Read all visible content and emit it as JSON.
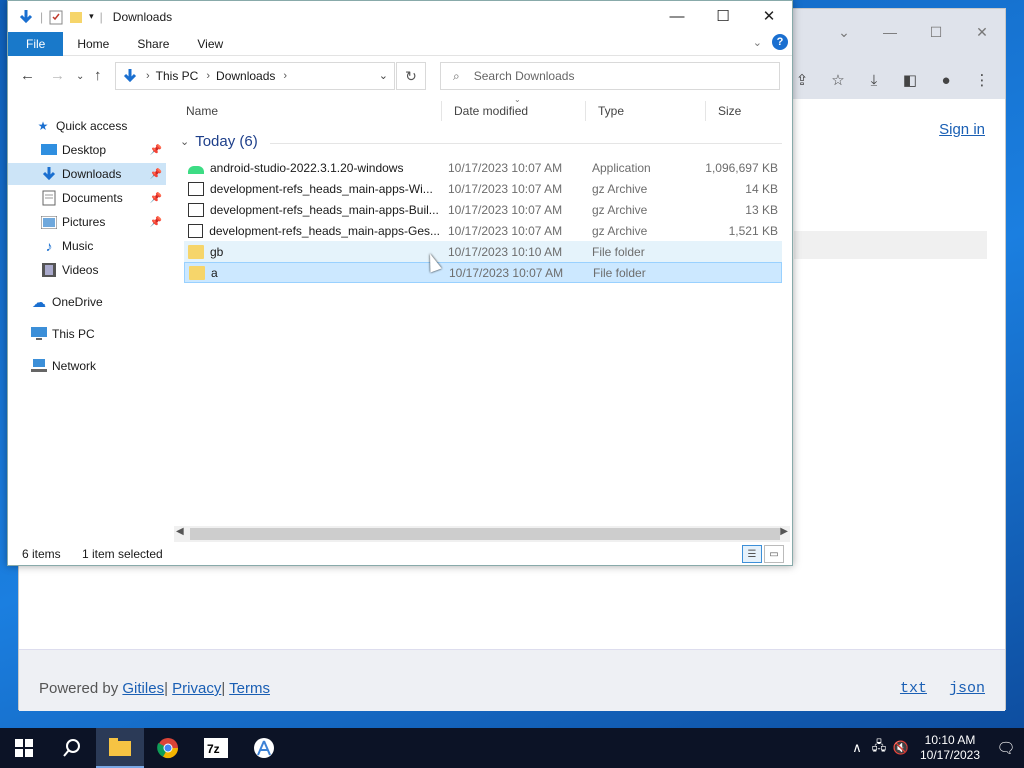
{
  "browser": {
    "sign_in": "Sign in",
    "footer_powered": "Powered by",
    "footer_gitiles": "Gitiles",
    "footer_privacy": "Privacy",
    "footer_terms": "Terms",
    "footer_txt": "txt",
    "footer_json": "json",
    "sep": "|"
  },
  "explorer": {
    "title": "Downloads",
    "ribbon_tabs": [
      "File",
      "Home",
      "Share",
      "View"
    ],
    "help": "?",
    "address": {
      "crumbs": [
        "This PC",
        "Downloads"
      ]
    },
    "search_placeholder": "Search Downloads",
    "nav": {
      "quick_access": "Quick access",
      "items": [
        "Desktop",
        "Downloads",
        "Documents",
        "Pictures",
        "Music",
        "Videos"
      ],
      "onedrive": "OneDrive",
      "this_pc": "This PC",
      "network": "Network"
    },
    "columns": [
      "Name",
      "Date modified",
      "Type",
      "Size"
    ],
    "group_label": "Today (6)",
    "files": [
      {
        "name": "android-studio-2022.3.1.20-windows",
        "date": "10/17/2023 10:07 AM",
        "type": "Application",
        "size": "1,096,697 KB",
        "icon": "android-app-icon"
      },
      {
        "name": "development-refs_heads_main-apps-Wi...",
        "date": "10/17/2023 10:07 AM",
        "type": "gz Archive",
        "size": "14 KB",
        "icon": "archive-icon"
      },
      {
        "name": "development-refs_heads_main-apps-Buil...",
        "date": "10/17/2023 10:07 AM",
        "type": "gz Archive",
        "size": "13 KB",
        "icon": "archive-icon"
      },
      {
        "name": "development-refs_heads_main-apps-Ges...",
        "date": "10/17/2023 10:07 AM",
        "type": "gz Archive",
        "size": "1,521 KB",
        "icon": "archive-icon"
      },
      {
        "name": "gb",
        "date": "10/17/2023 10:10 AM",
        "type": "File folder",
        "size": "",
        "icon": "folder-icon"
      },
      {
        "name": "a",
        "date": "10/17/2023 10:07 AM",
        "type": "File folder",
        "size": "",
        "icon": "folder-icon"
      }
    ],
    "status_items": "6 items",
    "status_selected": "1 item selected"
  },
  "taskbar": {
    "time": "10:10 AM",
    "date": "10/17/2023"
  }
}
